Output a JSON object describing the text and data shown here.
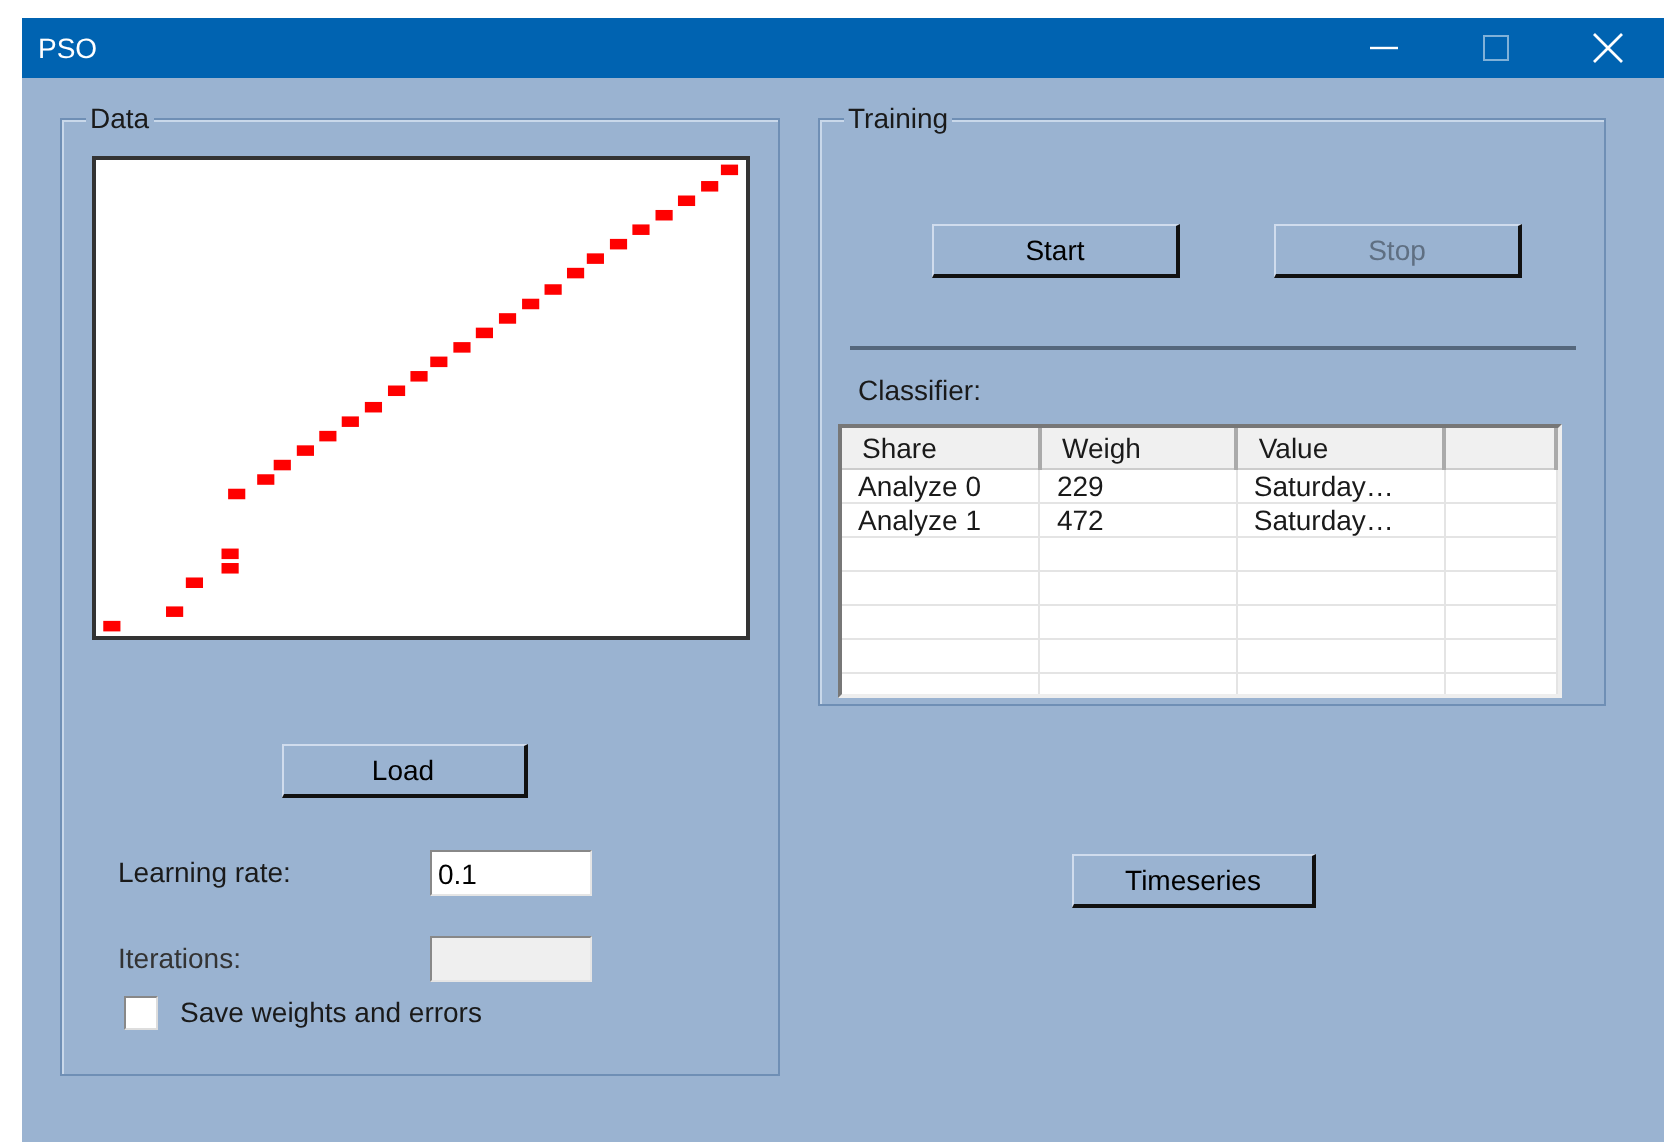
{
  "window": {
    "title": "PSO"
  },
  "data_group": {
    "title": "Data",
    "load_button": "Load",
    "learning_rate": {
      "label": "Learning rate:",
      "value": "0.1",
      "disabled": false
    },
    "iterations": {
      "label": "Iterations:",
      "disabled": true
    },
    "save_checkbox": {
      "label": "Save weights and errors",
      "checked": false
    }
  },
  "training_group": {
    "title": "Training",
    "buttons": [
      {
        "label": "Start",
        "disabled": false
      },
      {
        "label": "Stop",
        "disabled": true
      }
    ],
    "classifier_label": "Classifier:",
    "table": {
      "columns": [
        "Share",
        "Weigh",
        "Value"
      ],
      "rows": [
        [
          "Analyze 0",
          "229",
          "Saturday…"
        ],
        [
          "Analyze 1",
          "472",
          "Saturday…"
        ]
      ]
    }
  },
  "timeseries_button": "Timeseries"
}
